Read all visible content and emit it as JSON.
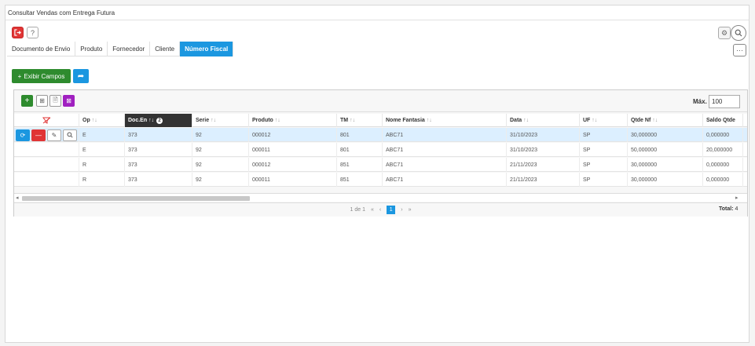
{
  "window": {
    "title": "Consultar Vendas com Entrega Futura"
  },
  "colors": {
    "accent": "#1b97e0",
    "danger": "#e03535",
    "success": "#2e8b2e",
    "purple": "#a020c0",
    "sorted_header": "#333333",
    "selected_row": "#dcefff"
  },
  "toolbar": {
    "exit_icon": "exit-icon",
    "help_label": "?",
    "more_label": "···"
  },
  "tabs": [
    {
      "label": "Documento de Envio",
      "active": false
    },
    {
      "label": "Produto",
      "active": false
    },
    {
      "label": "Fornecedor",
      "active": false
    },
    {
      "label": "Cliente",
      "active": false
    },
    {
      "label": "Número Fiscal",
      "active": true
    }
  ],
  "actions": {
    "show_fields_label": "Exibir Campos",
    "show_fields_icon": "+"
  },
  "grid": {
    "max_label": "Máx.",
    "max_value": "100",
    "columns": [
      {
        "label": "Op",
        "sort_icon": "↑↓"
      },
      {
        "label": "Doc.En",
        "sort_icon": "↑↓",
        "sorted": true,
        "sort_order": "2"
      },
      {
        "label": "Serie",
        "sort_icon": "↑↓"
      },
      {
        "label": "Produto",
        "sort_icon": "↑↓"
      },
      {
        "label": "TM",
        "sort_icon": "↑↓"
      },
      {
        "label": "Nome Fantasia",
        "sort_icon": "↑↓"
      },
      {
        "label": "Data",
        "sort_icon": "↑↓"
      },
      {
        "label": "UF",
        "sort_icon": "↑↓"
      },
      {
        "label": "Qtde Nf",
        "sort_icon": "↑↓"
      },
      {
        "label": "Saldo Qtde",
        "sort_icon": ""
      }
    ],
    "rows": [
      {
        "op": "E",
        "doc": "373",
        "serie": "92",
        "produto": "000012",
        "tm": "801",
        "nome": "ABC71",
        "data": "31/10/2023",
        "uf": "SP",
        "qtde": "30,000000",
        "saldo": "0,000000",
        "selected": true
      },
      {
        "op": "E",
        "doc": "373",
        "serie": "92",
        "produto": "000011",
        "tm": "801",
        "nome": "ABC71",
        "data": "31/10/2023",
        "uf": "SP",
        "qtde": "50,000000",
        "saldo": "20,000000",
        "selected": false
      },
      {
        "op": "R",
        "doc": "373",
        "serie": "92",
        "produto": "000012",
        "tm": "851",
        "nome": "ABC71",
        "data": "21/11/2023",
        "uf": "SP",
        "qtde": "30,000000",
        "saldo": "0,000000",
        "selected": false
      },
      {
        "op": "R",
        "doc": "373",
        "serie": "92",
        "produto": "000011",
        "tm": "851",
        "nome": "ABC71",
        "data": "21/11/2023",
        "uf": "SP",
        "qtde": "30,000000",
        "saldo": "0,000000",
        "selected": false
      }
    ],
    "pager": {
      "info": "1 de 1",
      "first": "«",
      "prev": "‹",
      "current": "1",
      "next": "›",
      "last": "»"
    },
    "total_label": "Total:",
    "total_value": "4"
  }
}
